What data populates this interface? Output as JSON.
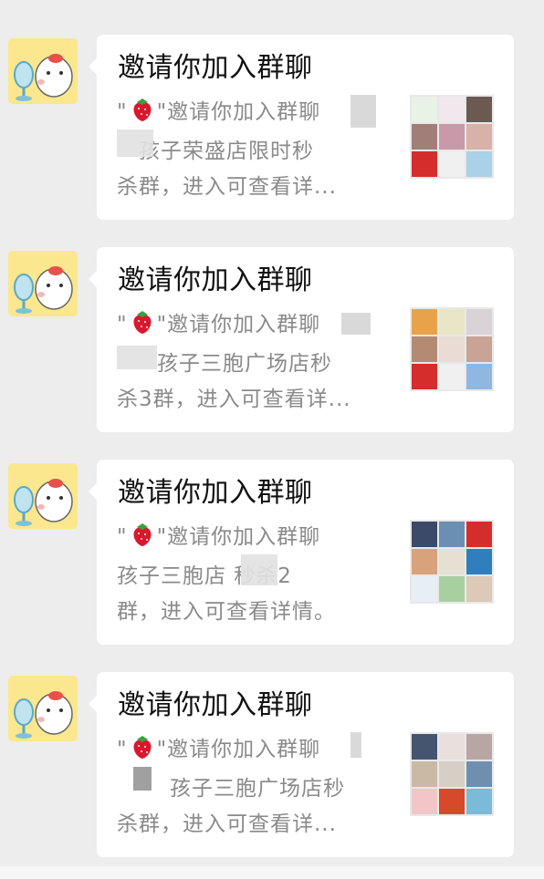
{
  "messages": [
    {
      "title": "邀请你加入群聊",
      "desc_l1_a": "\"",
      "desc_l1_b": "\"邀请你加入群聊",
      "desc_l2": "孩子荣盛店限时秒",
      "desc_l3": "杀群，进入可查看详...",
      "thumb_colors": [
        "#e9f2e6",
        "#f0e8ec",
        "#6b5a52",
        "#a17f78",
        "#c89aa9",
        "#d8b2a8",
        "#d42d2b",
        "#f0f0f0",
        "#a9d1e8"
      ]
    },
    {
      "title": "邀请你加入群聊",
      "desc_l1_a": "\"",
      "desc_l1_b": "\"邀请你加入群聊",
      "desc_l2": "孩子三胞广场店秒",
      "desc_l3": "杀3群，进入可查看详...",
      "thumb_colors": [
        "#e8a34a",
        "#e9e6c8",
        "#d9d2d6",
        "#b58a73",
        "#eadcd4",
        "#c9a395",
        "#d42d2b",
        "#f0f0f0",
        "#8fb7e0"
      ]
    },
    {
      "title": "邀请你加入群聊",
      "desc_l1_a": "\"",
      "desc_l1_b": "\"邀请你加入群聊",
      "desc_l2": "孩子三胞店   秒杀2",
      "desc_l3": "群，进入可查看详情。",
      "thumb_colors": [
        "#3a4a68",
        "#6a8fb2",
        "#d42d2b",
        "#d8a27a",
        "#e5e0d2",
        "#2f7fbf",
        "#e7eef4",
        "#a8cfa0",
        "#dcc9b8"
      ]
    },
    {
      "title": "邀请你加入群聊",
      "desc_l1_a": "\"",
      "desc_l1_b": "\"邀请你加入群聊",
      "desc_l2": "孩子三胞广场店秒",
      "desc_l3": "杀群，进入可查看详...",
      "thumb_colors": [
        "#45556f",
        "#e9dfdb",
        "#b7a6a4",
        "#c9b9a5",
        "#d6cfc6",
        "#6f8fb0",
        "#f2c5c8",
        "#d64a2b",
        "#7bbbd9"
      ]
    }
  ]
}
